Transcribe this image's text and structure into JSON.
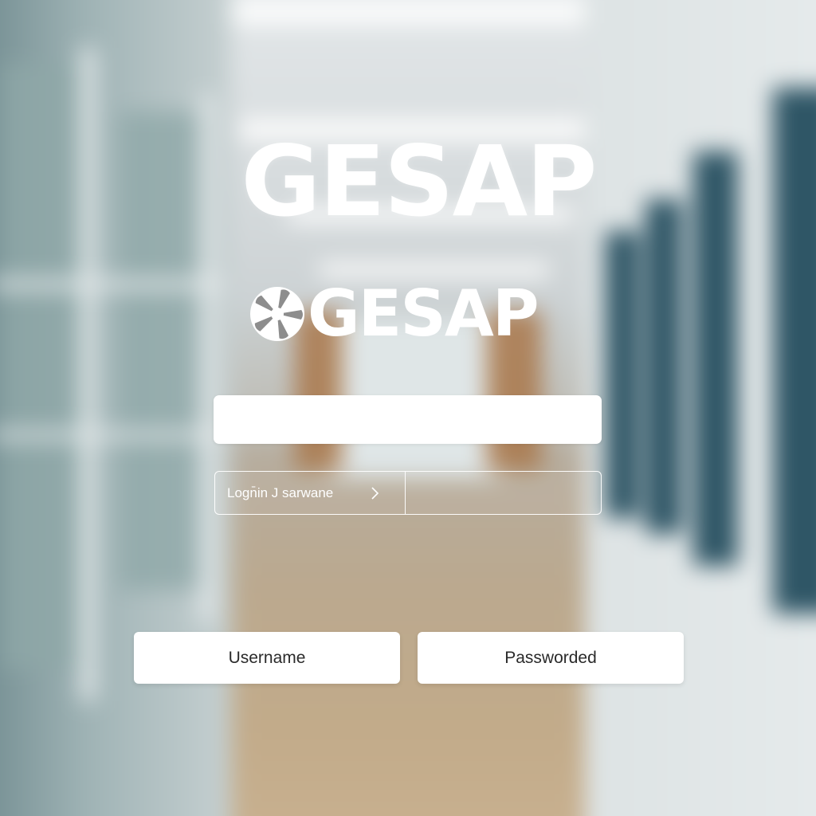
{
  "app": {
    "title": "GESAP",
    "brand_text": "GESAP",
    "logo_icon": "flower-logo-icon"
  },
  "form": {
    "top_field_value": "",
    "login_label": "Logn̄in J sarwane",
    "login_chevron_icon": "chevron-right-icon",
    "login_value_field": ""
  },
  "buttons": {
    "username_label": "Username",
    "password_label": "Passworded"
  },
  "colors": {
    "text_on_background": "#ffffff",
    "field_background": "#ffffff",
    "button_text": "#2a2a2a",
    "pillar_blue": "#2f5666"
  }
}
